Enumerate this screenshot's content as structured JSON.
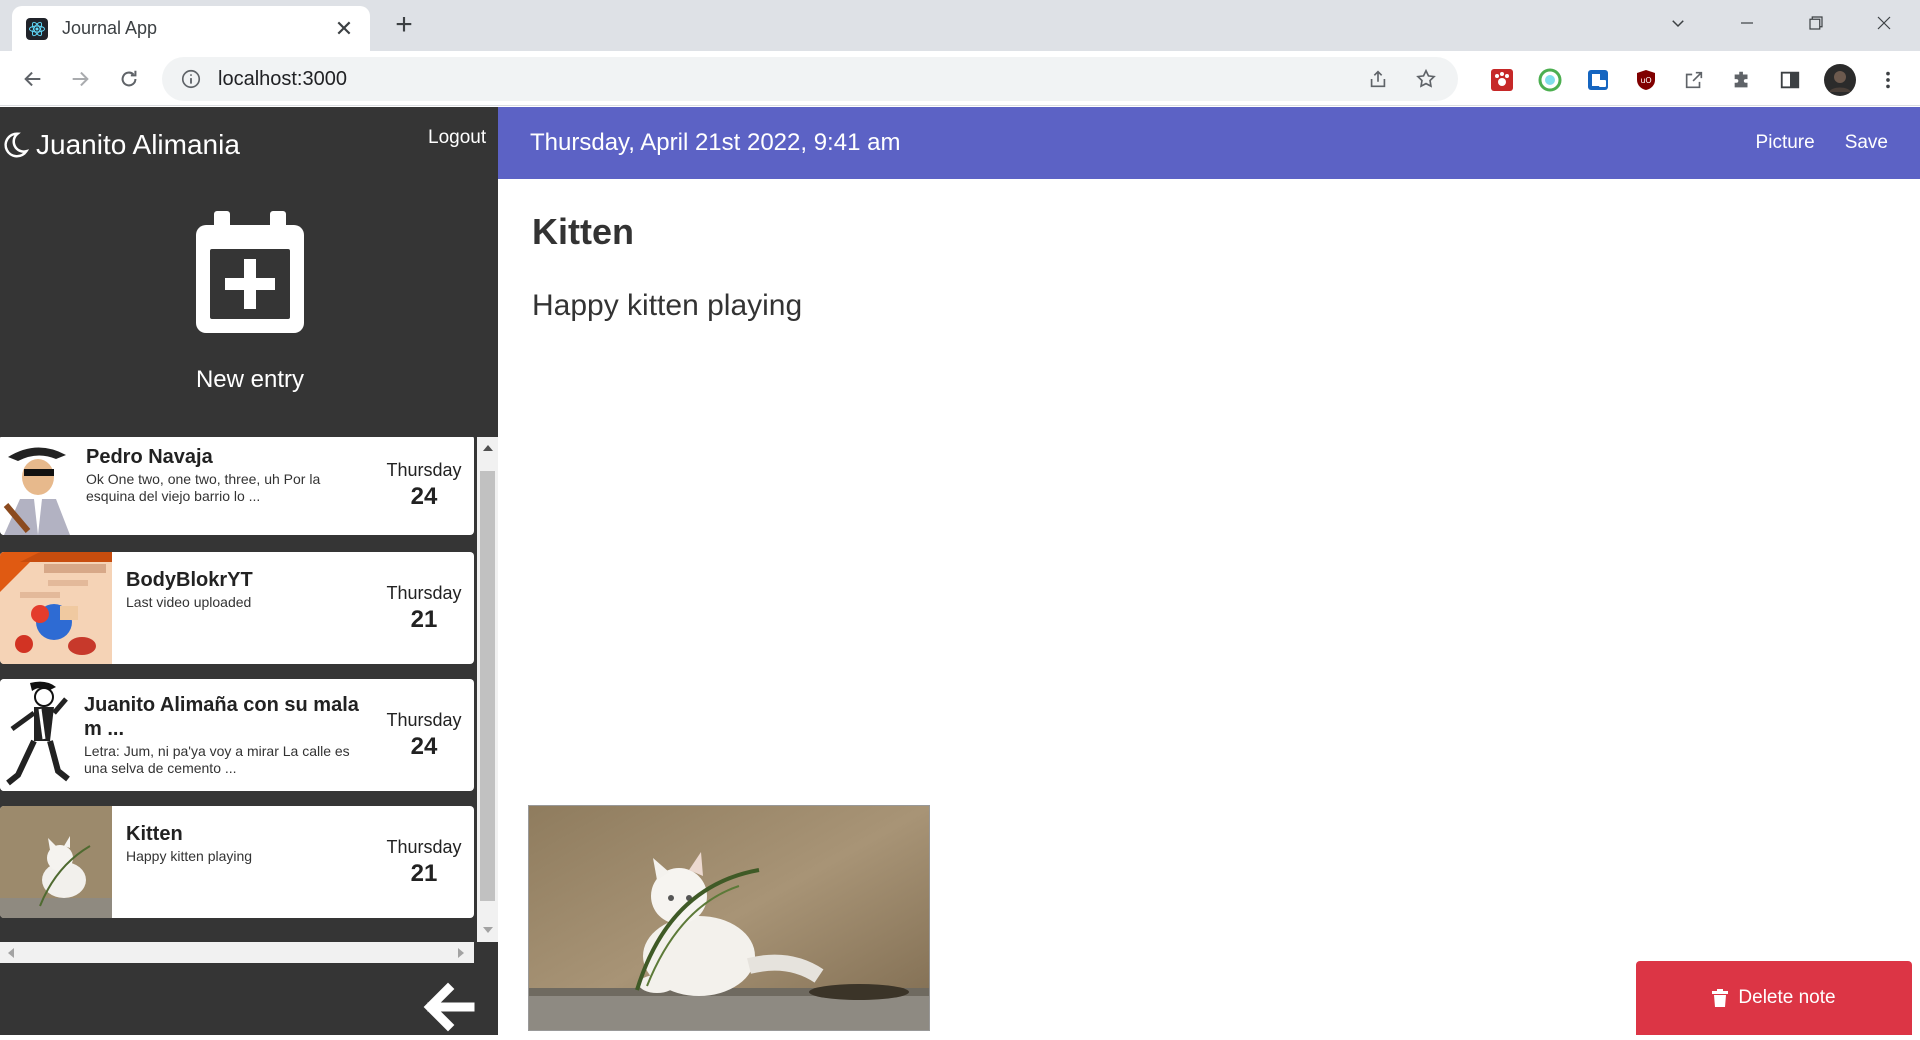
{
  "browser": {
    "tab_title": "Journal App",
    "url": "localhost:3000"
  },
  "sidebar": {
    "user_name": "Juanito Alimania",
    "logout_label": "Logout",
    "new_entry_label": "New entry",
    "entries": [
      {
        "title": "Pedro Navaja",
        "text": "Ok One two, one two, three, uh Por la esquina del viejo barrio lo ...",
        "day": "Thursday",
        "date": "24"
      },
      {
        "title": "BodyBlokrYT",
        "text": "Last video uploaded",
        "day": "Thursday",
        "date": "21"
      },
      {
        "title": "Juanito Alimaña con su mala m ...",
        "text": "Letra: Jum, ni pa'ya voy a mirar La calle es una selva de cemento ...",
        "day": "Thursday",
        "date": "24"
      },
      {
        "title": "Kitten",
        "text": "Happy kitten playing",
        "day": "Thursday",
        "date": "21"
      }
    ]
  },
  "main": {
    "date": "Thursday, April 21st 2022, 9:41 am",
    "picture_label": "Picture",
    "save_label": "Save",
    "note_title": "Kitten",
    "note_body": "Happy kitten playing",
    "delete_label": "Delete note"
  },
  "colors": {
    "sidebar_bg": "#353535",
    "topbar_bg": "#5c62c5",
    "delete_bg": "#dc3545"
  }
}
